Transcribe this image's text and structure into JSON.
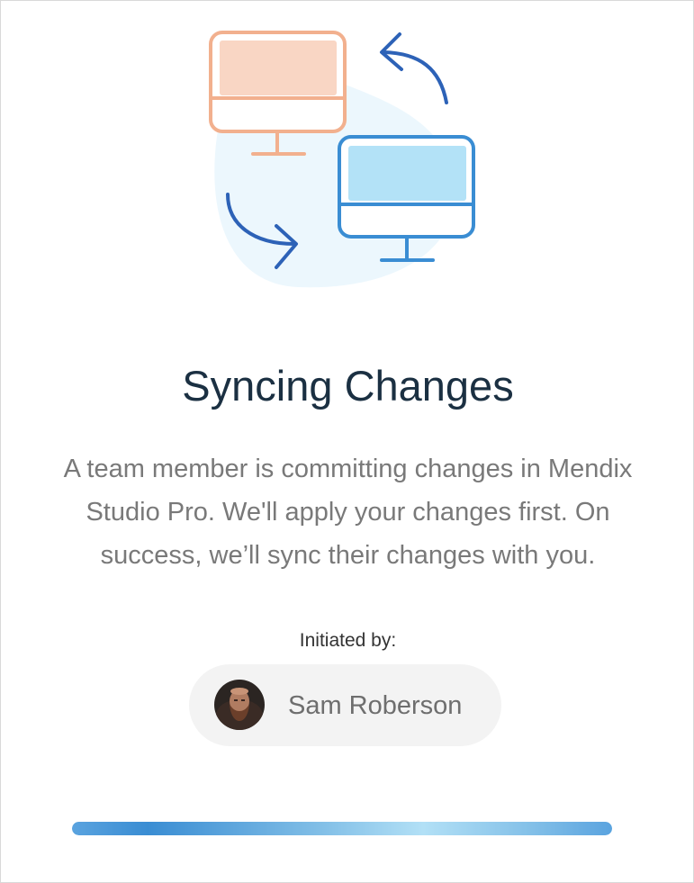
{
  "dialog": {
    "title": "Syncing Changes",
    "description_lines": [
      "A team member is committing changes in Mendix",
      "Studio Pro. We'll apply your changes first. On",
      "success, we’ll sync their changes with you."
    ],
    "initiated_label": "Initiated by:",
    "user": {
      "name": "Sam Roberson",
      "avatar": "user-avatar-photo"
    },
    "progress": {
      "value_percent": 100,
      "style": "indeterminate-shimmer"
    }
  },
  "illustration": {
    "icons": [
      "monitor-icon",
      "monitor-icon",
      "sync-arrow-icon",
      "sync-arrow-icon"
    ]
  },
  "colors": {
    "title": "#1b3042",
    "text": "#797979",
    "monitor_orange": "#f2b08e",
    "monitor_orange_fill": "#f9d6c4",
    "monitor_blue": "#3a8dd3",
    "monitor_blue_fill": "#b3e2f7",
    "arrow_blue": "#2d62b7",
    "blob": "#ecf7fd",
    "chip_bg": "#f3f3f3",
    "progress": "#5aa3df"
  }
}
